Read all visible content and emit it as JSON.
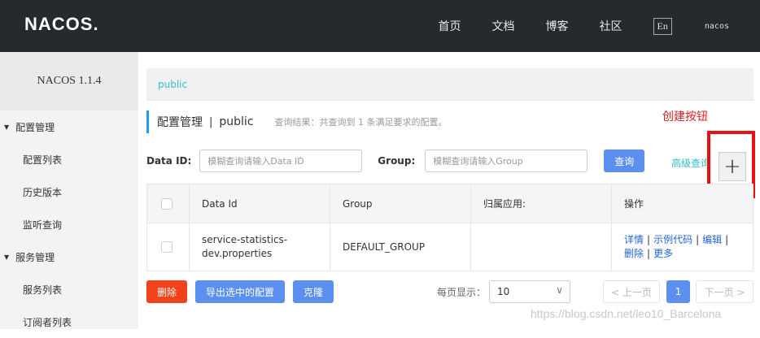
{
  "header": {
    "logo": "NACOS.",
    "nav": [
      "首页",
      "文档",
      "博客",
      "社区"
    ],
    "lang": "En",
    "user": "nacos"
  },
  "sidebar": {
    "version": "NACOS 1.1.4",
    "groups": [
      {
        "label": "配置管理",
        "items": [
          "配置列表",
          "历史版本",
          "监听查询"
        ]
      },
      {
        "label": "服务管理",
        "items": [
          "服务列表",
          "订阅者列表"
        ]
      }
    ]
  },
  "namespace": {
    "name": "public"
  },
  "breadcrumb": {
    "title": "配置管理",
    "separator": "|",
    "namespace": "public",
    "result_hint": "查询结果：共查询到 1 条满足要求的配置。"
  },
  "annotation": "创建按钮",
  "search": {
    "dataid_label": "Data ID:",
    "dataid_placeholder": "模糊查询请输入Data ID",
    "group_label": "Group:",
    "group_placeholder": "模糊查询请输入Group",
    "query_button": "查询",
    "advanced_link": "高级查询",
    "add_symbol": "+"
  },
  "table": {
    "columns": [
      "Data Id",
      "Group",
      "归属应用:",
      "操作"
    ],
    "rows": [
      {
        "data_id_line1": "service-statistics-",
        "data_id_line2": "dev.properties",
        "group": "DEFAULT_GROUP",
        "app": "",
        "ops": [
          "详情",
          "示例代码",
          "编辑",
          "删除",
          "更多"
        ]
      }
    ]
  },
  "footer": {
    "delete_button": "删除",
    "export_button": "导出选中的配置",
    "clone_button": "克隆",
    "page_size_label": "每页显示：",
    "page_size_value": "10",
    "prev_label": "< 上一页",
    "current_page": "1",
    "next_label": "下一页 >"
  },
  "watermark": "https://blog.csdn.net/leo10_Barcelona",
  "colors": {
    "topbar": "#252a2f",
    "primary": "#5b8ff0",
    "danger": "#f2421b",
    "accent": "#2fc1c9",
    "annotation": "#e02020"
  }
}
